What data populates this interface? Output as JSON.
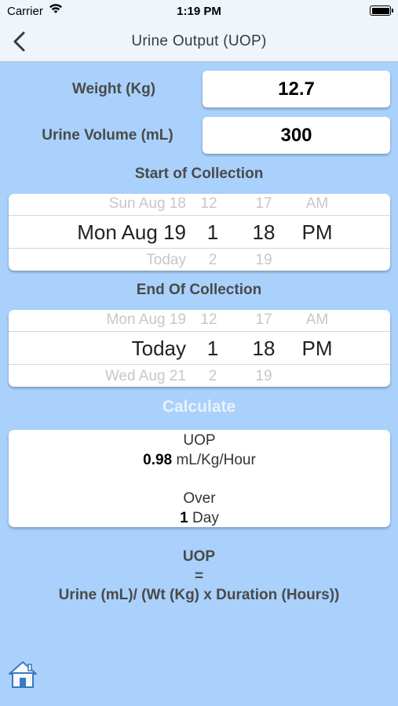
{
  "status": {
    "carrier": "Carrier",
    "time": "1:19 PM"
  },
  "nav": {
    "title": "Urine Output (UOP)"
  },
  "weight": {
    "label": "Weight (Kg)",
    "value": "12.7"
  },
  "volume": {
    "label": "Urine Volume (mL)",
    "value": "300"
  },
  "start": {
    "title": "Start of Collection",
    "above": {
      "date": "Sun Aug 18",
      "hour": "12",
      "minute": "17",
      "ampm": "AM"
    },
    "selected": {
      "date": "Mon Aug 19",
      "hour": "1",
      "minute": "18",
      "ampm": "PM"
    },
    "below": {
      "date": "Today",
      "hour": "2",
      "minute": "19",
      "ampm": ""
    }
  },
  "end": {
    "title": "End Of Collection",
    "above": {
      "date": "Mon Aug 19",
      "hour": "12",
      "minute": "17",
      "ampm": "AM"
    },
    "selected": {
      "date": "Today",
      "hour": "1",
      "minute": "18",
      "ampm": "PM"
    },
    "below": {
      "date": "Wed Aug 21",
      "hour": "2",
      "minute": "19",
      "ampm": ""
    }
  },
  "calculate_label": "Calculate",
  "result": {
    "uop_title": "UOP",
    "uop_value": "0.98",
    "uop_unit": "mL/Kg/Hour",
    "over_title": "Over",
    "over_value": "1",
    "over_unit": "Day"
  },
  "formula": {
    "line1": "UOP",
    "line2": "=",
    "line3": "Urine (mL)/ (Wt (Kg) x Duration (Hours))"
  },
  "icons": {
    "back": "chevron-left-icon",
    "home": "home-icon",
    "wifi": "wifi-icon",
    "battery": "battery-icon"
  }
}
